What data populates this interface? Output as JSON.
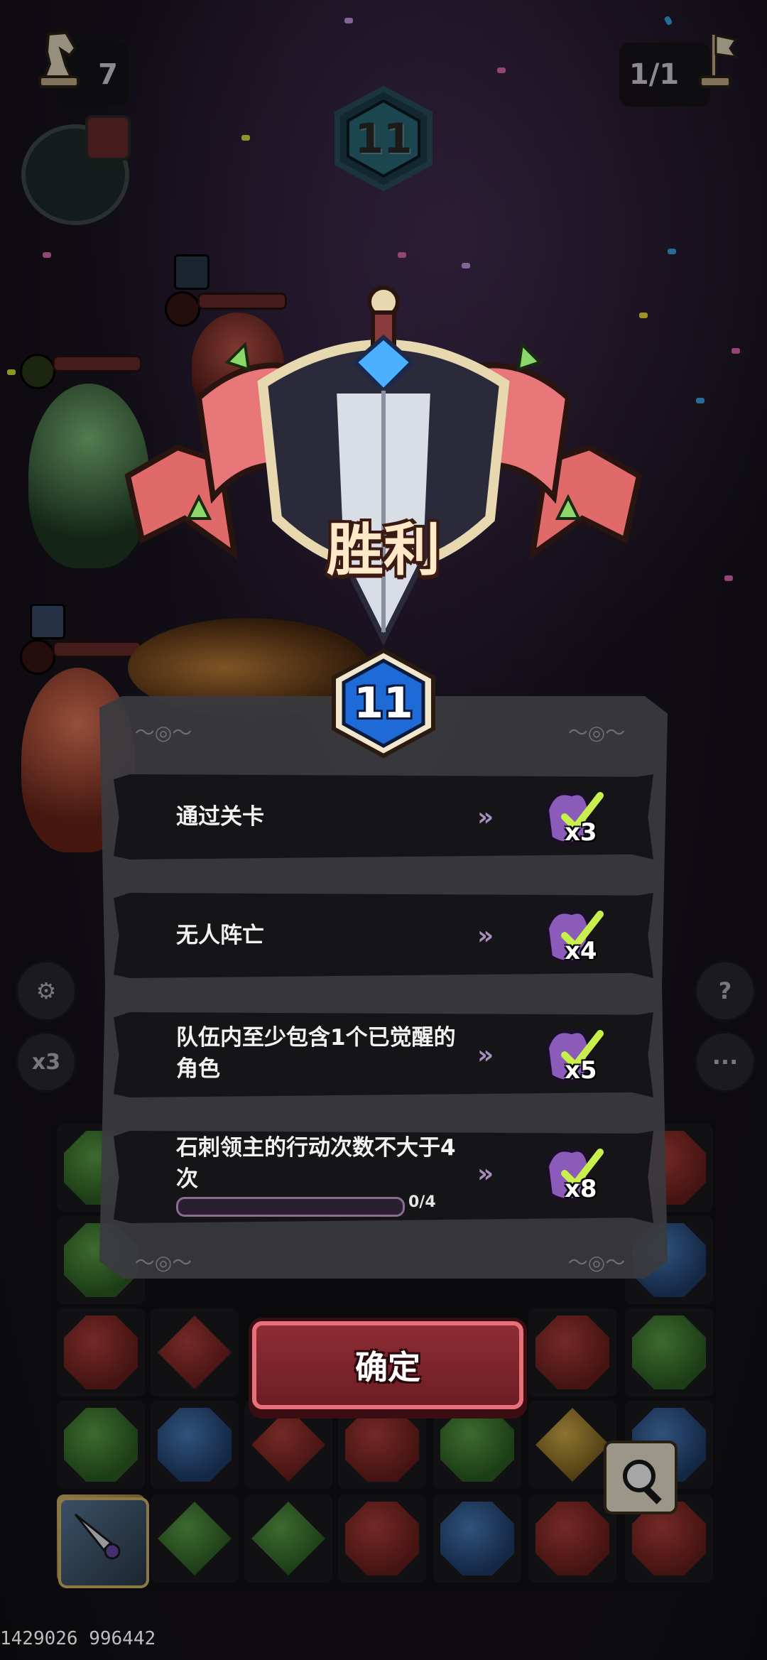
{
  "hud": {
    "moves_left": "7",
    "stage_progress": "1/1",
    "turn_number": "11",
    "speed_label": "x3"
  },
  "victory": {
    "title": "胜利",
    "level": "11"
  },
  "objectives": [
    {
      "text": "通过关卡",
      "reward_count": "x3",
      "completed": true
    },
    {
      "text": "无人阵亡",
      "reward_count": "x4",
      "completed": true
    },
    {
      "text": "队伍内至少包含1个已觉醒的角色",
      "reward_count": "x5",
      "completed": true
    },
    {
      "text": "石刺领主的行动次数不大于4次",
      "reward_count": "x8",
      "completed": true,
      "progress_text": "0/4",
      "progress_fraction": 0.0
    }
  ],
  "confirm_label": "确定",
  "footer_id": "1429026 996442",
  "colors": {
    "accent_red": "#8e2c33",
    "check_green": "#c8f04a",
    "reward_purple": "#8a5bb8"
  },
  "icons": {
    "moves": "chess-knight-icon",
    "stage": "flag-icon",
    "settings": "gear-icon",
    "help": "question-icon",
    "more": "ellipsis-icon",
    "inspect": "magnifier-icon"
  }
}
